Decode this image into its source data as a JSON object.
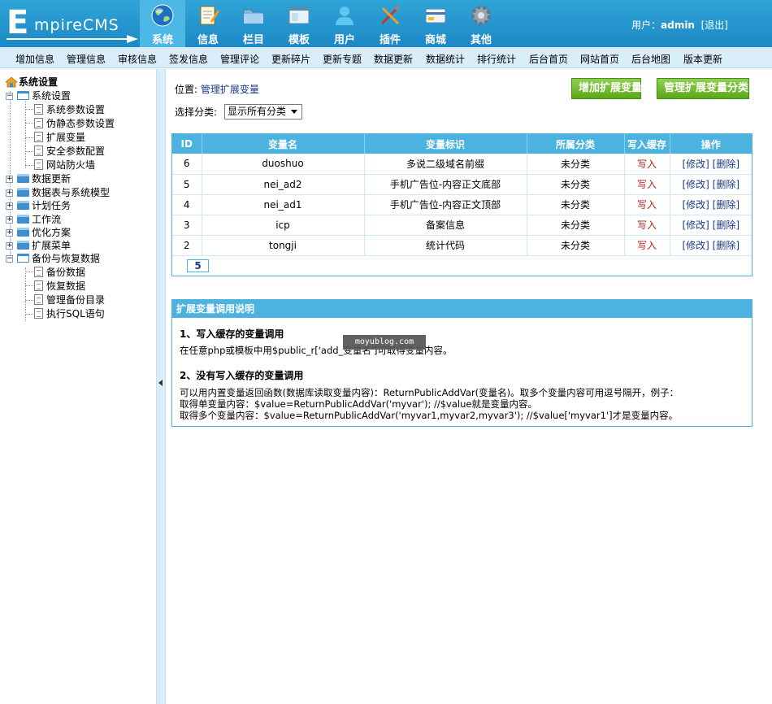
{
  "header": {
    "logo_e": "E",
    "logo_rest": "mpireCMS",
    "nav": [
      {
        "label": "系统",
        "icon": "globe-icon",
        "active": true
      },
      {
        "label": "信息",
        "icon": "notepad-icon"
      },
      {
        "label": "栏目",
        "icon": "folder-icon"
      },
      {
        "label": "模板",
        "icon": "window-icon"
      },
      {
        "label": "用户",
        "icon": "user-icon"
      },
      {
        "label": "插件",
        "icon": "tools-icon"
      },
      {
        "label": "商城",
        "icon": "card-icon"
      },
      {
        "label": "其他",
        "icon": "gear-icon"
      }
    ],
    "user_prefix": "用户：",
    "username": "admin",
    "logout": "[退出]"
  },
  "subnav": [
    "增加信息",
    "管理信息",
    "审核信息",
    "签发信息",
    "管理评论",
    "更新碎片",
    "更新专题",
    "数据更新",
    "数据统计",
    "排行统计",
    "后台首页",
    "网站首页",
    "后台地图",
    "版本更新"
  ],
  "tree": {
    "root": "系统设置",
    "items": [
      {
        "label": "系统设置"
      },
      {
        "label": "系统参数设置"
      },
      {
        "label": "伪静态参数设置"
      },
      {
        "label": "扩展变量"
      },
      {
        "label": "安全参数配置"
      },
      {
        "label": "网站防火墙"
      },
      {
        "label": "数据更新"
      },
      {
        "label": "数据表与系统模型"
      },
      {
        "label": "计划任务"
      },
      {
        "label": "工作流"
      },
      {
        "label": "优化方案"
      },
      {
        "label": "扩展菜单"
      },
      {
        "label": "备份与恢复数据"
      },
      {
        "label": "备份数据"
      },
      {
        "label": "恢复数据"
      },
      {
        "label": "管理备份目录"
      },
      {
        "label": "执行SQL语句"
      }
    ]
  },
  "main": {
    "breadcrumb_prefix": "位置: ",
    "breadcrumb_link": "管理扩展变量",
    "add_button": "增加扩展变量",
    "manage_button": "管理扩展变量分类",
    "filter_label": "选择分类:",
    "filter_value": "显示所有分类",
    "table": {
      "headers": [
        "ID",
        "变量名",
        "变量标识",
        "所属分类",
        "写入缓存",
        "操作"
      ],
      "rows": [
        {
          "id": "6",
          "name": "duoshuo",
          "label": "多说二级域名前缀",
          "category": "未分类",
          "cache": "写入",
          "edit": "[修改]",
          "del": "[删除]"
        },
        {
          "id": "5",
          "name": "nei_ad2",
          "label": "手机广告位-内容正文底部",
          "category": "未分类",
          "cache": "写入",
          "edit": "[修改]",
          "del": "[删除]"
        },
        {
          "id": "4",
          "name": "nei_ad1",
          "label": "手机广告位-内容正文顶部",
          "category": "未分类",
          "cache": "写入",
          "edit": "[修改]",
          "del": "[删除]"
        },
        {
          "id": "3",
          "name": "icp",
          "label": "备案信息",
          "category": "未分类",
          "cache": "写入",
          "edit": "[修改]",
          "del": "[删除]"
        },
        {
          "id": "2",
          "name": "tongji",
          "label": "统计代码",
          "category": "未分类",
          "cache": "写入",
          "edit": "[修改]",
          "del": "[删除]"
        }
      ],
      "pager": "5"
    },
    "help": {
      "title": "扩展变量调用说明",
      "h1": "1、写入缓存的变量调用",
      "p1": "在任意php或模板中用$public_r['add_变量名']可取得变量内容。",
      "h2": "2、没有写入缓存的变量调用",
      "p2": "可以用内置变量返回函数(数据库读取变量内容)：ReturnPublicAddVar(变量名)。取多个变量内容可用逗号隔开，例子：",
      "p3": "取得单变量内容：$value=ReturnPublicAddVar('myvar'); //$value就是变量内容。",
      "p4": "取得多个变量内容：$value=ReturnPublicAddVar('myvar1,myvar2,myvar3'); //$value['myvar1']才是变量内容。"
    },
    "watermark": "moyublog.com"
  }
}
